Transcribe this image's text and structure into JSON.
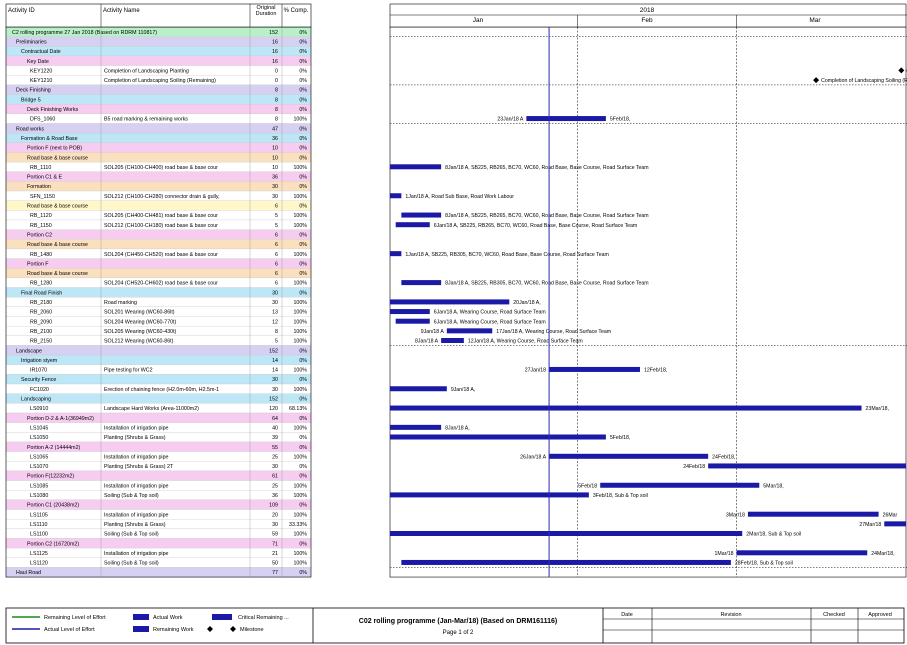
{
  "columns": {
    "id": "Activity ID",
    "name": "Activity Name",
    "dur": "Original Duration",
    "pct": "% Comp."
  },
  "timescale": {
    "year": "2018",
    "months": [
      "Jan",
      "Feb",
      "Mar"
    ]
  },
  "colors": {
    "wbs1": "#b9f0c8",
    "wbs2": "#d6d0f2",
    "wbs3": "#bde6f6",
    "wbs4": "#f6ccf0",
    "wbs5": "#fbe0c0",
    "wbs6": "#fff7c8",
    "activity": "#ffffff",
    "bar": "#1a1aa6",
    "data_date": "#2a2ab0"
  },
  "chart_data": {
    "type": "gantt",
    "title": "C02 rolling programme (Jan-Mar/18) (Based on DRM161116)",
    "x_range": [
      "2017-12-30",
      "2018-03-31"
    ],
    "data_date": "2018-01-27",
    "rows": [
      {
        "id": "C2 rolling programme 27 Jan 2018 (Based on RDRM 110817)",
        "name": "",
        "dur": "152",
        "pct": "0%",
        "level": 0
      },
      {
        "id": "Preliminaries",
        "name": "",
        "dur": "16",
        "pct": "0%",
        "level": 1
      },
      {
        "id": "Contractual Date",
        "name": "",
        "dur": "16",
        "pct": "0%",
        "level": 2
      },
      {
        "id": "Key Date",
        "name": "",
        "dur": "16",
        "pct": "0%",
        "level": 3
      },
      {
        "id": "KEY1220",
        "name": "Completion of Landscaping Planting",
        "dur": "0",
        "pct": "0%",
        "level": 9,
        "milestone": "2018-03-30",
        "label": "Co"
      },
      {
        "id": "KEY1210",
        "name": "Completion of Landscaping Soiling (Remaining)",
        "dur": "0",
        "pct": "0%",
        "level": 9,
        "milestone": "2018-03-15",
        "label": "Completion of Landscaping Soiling (R"
      },
      {
        "id": "Deck Finishing",
        "name": "",
        "dur": "8",
        "pct": "0%",
        "level": 1
      },
      {
        "id": "Bridge 5",
        "name": "",
        "dur": "8",
        "pct": "0%",
        "level": 2
      },
      {
        "id": "Deck Finishing Works",
        "name": "",
        "dur": "8",
        "pct": "0%",
        "level": 3
      },
      {
        "id": "DFS_1060",
        "name": "B5 road marking & remaining works",
        "dur": "8",
        "pct": "100%",
        "level": 9,
        "start": "2018-01-23",
        "end": "2018-02-06",
        "lbl_l": "23Jan/18 A",
        "lbl_r": "5Feb/18,"
      },
      {
        "id": "Road works",
        "name": "",
        "dur": "47",
        "pct": "0%",
        "level": 1
      },
      {
        "id": "Formation & Road Base",
        "name": "",
        "dur": "36",
        "pct": "0%",
        "level": 2
      },
      {
        "id": "Portion F (next to POB)",
        "name": "",
        "dur": "10",
        "pct": "0%",
        "level": 3
      },
      {
        "id": "Road base & base course",
        "name": "",
        "dur": "10",
        "pct": "0%",
        "level": 4
      },
      {
        "id": "RB_1110",
        "name": "SOL205 (CH100-CH400) road base & base cour",
        "dur": "10",
        "pct": "100%",
        "level": 9,
        "start": "2017-12-30",
        "end": "2018-01-08",
        "lbl_r": "8Jan/18 A, SB225, RB265, BC70, WC60, Road Base, Base Course, Road Surface Team"
      },
      {
        "id": "Portion C1 & E",
        "name": "",
        "dur": "36",
        "pct": "0%",
        "level": 3
      },
      {
        "id": "Formation",
        "name": "",
        "dur": "30",
        "pct": "0%",
        "level": 4
      },
      {
        "id": "SFN_1150",
        "name": "SOL212 (CH100-CH280) connector drain & gully,",
        "dur": "30",
        "pct": "100%",
        "level": 9,
        "start": "2017-12-30",
        "end": "2018-01-01",
        "lbl_r": "1Jan/18 A, Road Sub Base, Road Work Labour"
      },
      {
        "id": "Road base & base course",
        "name": "",
        "dur": "6",
        "pct": "0%",
        "level": 5
      },
      {
        "id": "RB_1120",
        "name": "SOL205 (CH400-CH481) road base & base cour",
        "dur": "5",
        "pct": "100%",
        "level": 9,
        "start": "2018-01-01",
        "end": "2018-01-08",
        "lbl_r": "8Jan/18 A, SB225, RB265, BC70, WC60, Road Base, Base Course, Road Surface Team"
      },
      {
        "id": "RB_1150",
        "name": "SOL212 (CH100-CH180) road base & base cour",
        "dur": "5",
        "pct": "100%",
        "level": 9,
        "start": "2017-12-31",
        "end": "2018-01-06",
        "lbl_r": "6Jan/18 A, SB225, RB265, BC70, WC60, Road Base, Base Course, Road Surface Team"
      },
      {
        "id": "Portion C2",
        "name": "",
        "dur": "6",
        "pct": "0%",
        "level": 3
      },
      {
        "id": "Road base & base course",
        "name": "",
        "dur": "6",
        "pct": "0%",
        "level": 4
      },
      {
        "id": "RB_1480",
        "name": "SOL204 (CH450-CH520) road base & base cour",
        "dur": "6",
        "pct": "100%",
        "level": 9,
        "start": "2017-12-30",
        "end": "2018-01-01",
        "lbl_r": "1Jan/18 A, SB225, RB305, BC70, WC60, Road Base, Base Course, Road Surface Team"
      },
      {
        "id": "Portion F",
        "name": "",
        "dur": "6",
        "pct": "0%",
        "level": 3
      },
      {
        "id": "Road base & base course",
        "name": "",
        "dur": "6",
        "pct": "0%",
        "level": 4
      },
      {
        "id": "RB_1280",
        "name": "SOL204 (CH520-CH602) road base & base cour",
        "dur": "6",
        "pct": "100%",
        "level": 9,
        "start": "2018-01-01",
        "end": "2018-01-08",
        "lbl_r": "8Jan/18 A, SB225, RB305, BC70, WC60, Road Base, Base Course, Road Surface Team"
      },
      {
        "id": "Final Road Finish",
        "name": "",
        "dur": "30",
        "pct": "0%",
        "level": 2
      },
      {
        "id": "RB_2180",
        "name": "Road marking",
        "dur": "30",
        "pct": "100%",
        "level": 9,
        "start": "2017-12-30",
        "end": "2018-01-20",
        "lbl_r": "20Jan/18 A,"
      },
      {
        "id": "RB_2060",
        "name": "SOL201 Wearing (WC60-86lt)",
        "dur": "13",
        "pct": "100%",
        "level": 9,
        "start": "2017-12-30",
        "end": "2018-01-06",
        "lbl_r": "6Jan/18 A, Wearing Course, Road Surface Team"
      },
      {
        "id": "RB_2090",
        "name": "SOL204 Wearing (WC60-770t)",
        "dur": "12",
        "pct": "100%",
        "level": 9,
        "start": "2017-12-31",
        "end": "2018-01-06",
        "lbl_r": "6Jan/18 A, Wearing Course, Road Surface Team"
      },
      {
        "id": "RB_2100",
        "name": "SOL205 Wearing (WC60-430t)",
        "dur": "8",
        "pct": "100%",
        "level": 9,
        "start": "2018-01-09",
        "end": "2018-01-17",
        "lbl_l": "9Jan/18 A",
        "lbl_r": "17Jan/18 A, Wearing Course, Road Surface Team"
      },
      {
        "id": "RB_2150",
        "name": "SOL212 Wearing (WC60-86t)",
        "dur": "5",
        "pct": "100%",
        "level": 9,
        "start": "2018-01-08",
        "end": "2018-01-12",
        "lbl_l": "8Jan/18 A",
        "lbl_r": "12Jan/18 A, Wearing Course, Road Surface Team"
      },
      {
        "id": "Landscape",
        "name": "",
        "dur": "152",
        "pct": "0%",
        "level": 1
      },
      {
        "id": "Irrigation styem",
        "name": "",
        "dur": "14",
        "pct": "0%",
        "level": 2
      },
      {
        "id": "IR1070",
        "name": "Pipe testing for WC2",
        "dur": "14",
        "pct": "100%",
        "level": 9,
        "start": "2018-01-27",
        "end": "2018-02-12",
        "lbl_l": "27Jan/18",
        "lbl_r": "12Feb/18,"
      },
      {
        "id": "Security Fence",
        "name": "",
        "dur": "30",
        "pct": "0%",
        "level": 2
      },
      {
        "id": "FC1020",
        "name": "Erection of chaining fence (H2.0m-60m, H2.5m-1",
        "dur": "30",
        "pct": "100%",
        "level": 9,
        "start": "2017-12-30",
        "end": "2018-01-09",
        "lbl_r": "9Jan/18 A,"
      },
      {
        "id": "Landscaping",
        "name": "",
        "dur": "152",
        "pct": "0%",
        "level": 2
      },
      {
        "id": "LS0910",
        "name": "Landscape Hard Works (Area-11000m2)",
        "dur": "120",
        "pct": "68.13%",
        "level": 9,
        "start": "2017-12-30",
        "end": "2018-03-23",
        "lbl_r": "23Mar/18,"
      },
      {
        "id": "Portion D-2 & A-1(36949m2)",
        "name": "",
        "dur": "64",
        "pct": "0%",
        "level": 3
      },
      {
        "id": "LS1045",
        "name": "Installation of irrigation pipe",
        "dur": "40",
        "pct": "100%",
        "level": 9,
        "start": "2017-12-30",
        "end": "2018-01-08",
        "lbl_r": "8Jan/18 A,"
      },
      {
        "id": "LS1050",
        "name": "Planting (Shrubs & Grass)",
        "dur": "39",
        "pct": "0%",
        "level": 9,
        "start": "2017-12-30",
        "end": "2018-02-06",
        "lbl_r": "5Feb/18,"
      },
      {
        "id": "Portion A-2 (14444m2)",
        "name": "",
        "dur": "55",
        "pct": "0%",
        "level": 3
      },
      {
        "id": "LS1065",
        "name": "Installation of irrigation pipe",
        "dur": "25",
        "pct": "100%",
        "level": 9,
        "start": "2018-01-27",
        "end": "2018-02-24",
        "lbl_l": "26Jan/18 A",
        "lbl_r": "24Feb/18,"
      },
      {
        "id": "LS1070",
        "name": "Planting (Shrubs & Grass) 2T",
        "dur": "30",
        "pct": "0%",
        "level": 9,
        "start": "2018-02-24",
        "end": "2018-03-31",
        "lbl_l": "24Feb/18"
      },
      {
        "id": "Portion F(12232m2)",
        "name": "",
        "dur": "61",
        "pct": "0%",
        "level": 3
      },
      {
        "id": "LS1085",
        "name": "Installation of irrigation pipe",
        "dur": "25",
        "pct": "100%",
        "level": 9,
        "start": "2018-02-05",
        "end": "2018-03-05",
        "lbl_l": "5Feb/18",
        "lbl_r": "5Mar/18,"
      },
      {
        "id": "LS1080",
        "name": "Soiling (Sub & Top soil)",
        "dur": "36",
        "pct": "100%",
        "level": 9,
        "start": "2017-12-30",
        "end": "2018-02-03",
        "lbl_r": "3Feb/18, Sub & Top soil"
      },
      {
        "id": "Portion C1 (20438m2)",
        "name": "",
        "dur": "109",
        "pct": "0%",
        "level": 3
      },
      {
        "id": "LS1105",
        "name": "Installation of irrigation pipe",
        "dur": "20",
        "pct": "100%",
        "level": 9,
        "start": "2018-03-03",
        "end": "2018-03-26",
        "lbl_l": "3Mar/18",
        "lbl_r": "26Mar"
      },
      {
        "id": "LS1110",
        "name": "Planting (Shrubs & Grass)",
        "dur": "30",
        "pct": "33.33%",
        "level": 9,
        "start": "2018-03-27",
        "end": "2018-03-31",
        "lbl_l": "27Mar/18"
      },
      {
        "id": "LS1100",
        "name": "Soiling (Sub & Top soil)",
        "dur": "59",
        "pct": "100%",
        "level": 9,
        "start": "2017-12-30",
        "end": "2018-03-02",
        "lbl_r": "2Mar/18, Sub & Top soil"
      },
      {
        "id": "Portion C2 (16720m2)",
        "name": "",
        "dur": "71",
        "pct": "0%",
        "level": 3
      },
      {
        "id": "LS1125",
        "name": "Installation of irrigation pipe",
        "dur": "21",
        "pct": "100%",
        "level": 9,
        "start": "2018-03-01",
        "end": "2018-03-24",
        "lbl_l": "1Mar/18",
        "lbl_r": "24Mar/18,"
      },
      {
        "id": "LS1120",
        "name": "Soiling (Sub & Top soil)",
        "dur": "50",
        "pct": "100%",
        "level": 9,
        "start": "2018-01-01",
        "end": "2018-02-28",
        "lbl_r": "28Feb/18, Sub & Top soil"
      },
      {
        "id": "Haul Road",
        "name": "",
        "dur": "77",
        "pct": "0%",
        "level": 1
      }
    ]
  },
  "footer": {
    "legend": [
      "Remaining Level of Effort",
      "Actual Level of Effort",
      "Actual Work",
      "Remaining Work",
      "Critical Remaining ...",
      "Milestone"
    ],
    "title": "C02 rolling programme (Jan-Mar/18) (Based on DRM161116)",
    "page": "Page 1 of 2",
    "table_headers": [
      "Date",
      "Revision",
      "Checked",
      "Approved"
    ]
  }
}
